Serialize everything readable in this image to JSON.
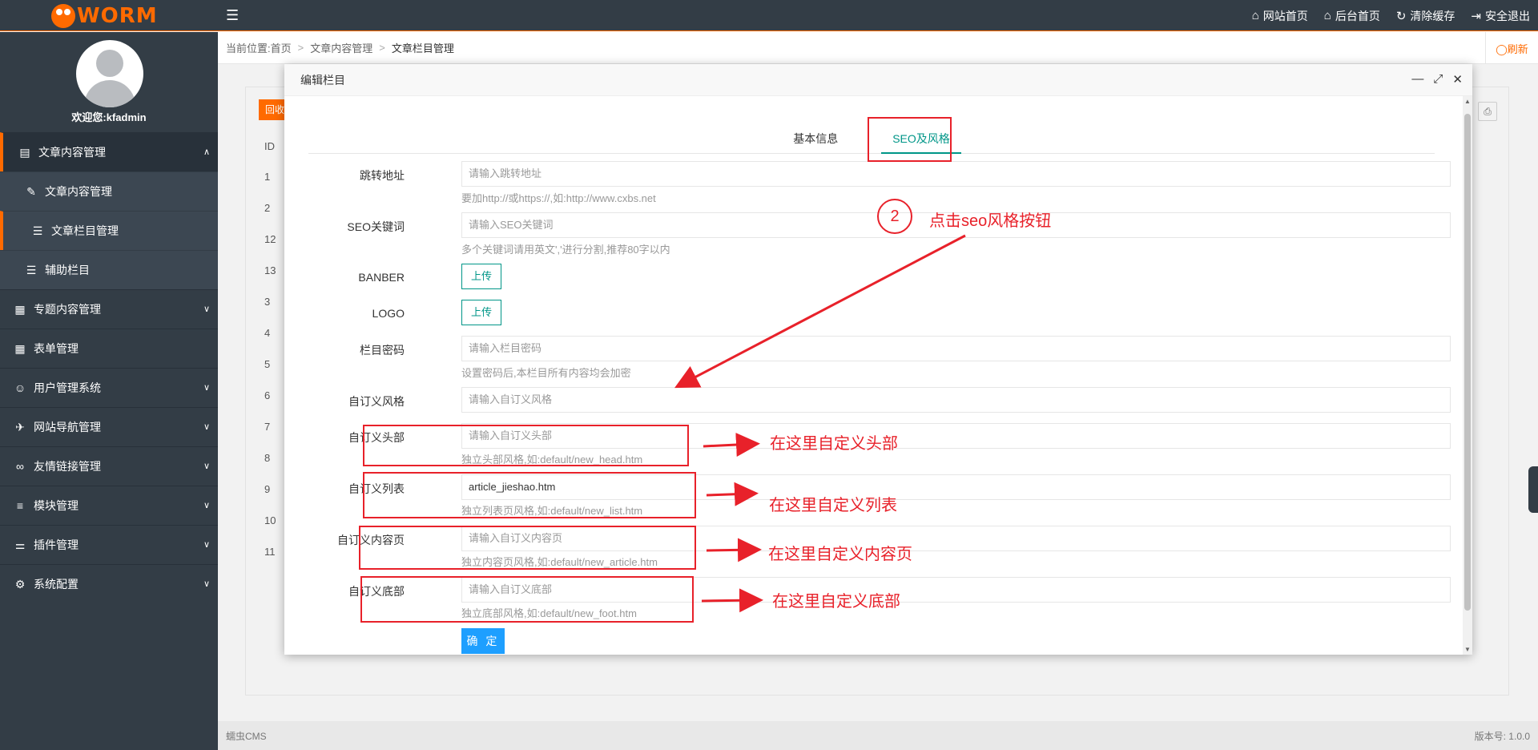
{
  "header": {
    "brand": "WORM",
    "links": [
      {
        "icon": "home-icon",
        "glyph": "⌂",
        "label": "网站首页"
      },
      {
        "icon": "admin-home-icon",
        "glyph": "⌂",
        "label": "后台首页"
      },
      {
        "icon": "refresh-cache-icon",
        "glyph": "↻",
        "label": "清除缓存"
      },
      {
        "icon": "logout-icon",
        "glyph": "⇥",
        "label": "安全退出"
      }
    ]
  },
  "sidebar": {
    "welcome": "欢迎您:kfadmin",
    "items": [
      {
        "label": "文章内容管理",
        "icon": "document-icon",
        "glyph": "▤",
        "chevron": "∧"
      },
      {
        "label": "文章内容管理",
        "icon": "edit-document-icon",
        "glyph": "✎"
      },
      {
        "label": "文章栏目管理",
        "icon": "list-icon",
        "glyph": "☰"
      },
      {
        "label": "辅助栏目",
        "icon": "list-icon",
        "glyph": "☰"
      },
      {
        "label": "专题内容管理",
        "icon": "topic-icon",
        "glyph": "▦",
        "chevron": "∨"
      },
      {
        "label": "表单管理",
        "icon": "grid-icon",
        "glyph": "▦",
        "chevron": ""
      },
      {
        "label": "用户管理系统",
        "icon": "users-icon",
        "glyph": "☺",
        "chevron": "∨"
      },
      {
        "label": "网站导航管理",
        "icon": "navigation-icon",
        "glyph": "✈",
        "chevron": "∨"
      },
      {
        "label": "友情链接管理",
        "icon": "link-icon",
        "glyph": "∞",
        "chevron": "∨"
      },
      {
        "label": "模块管理",
        "icon": "menu-icon",
        "glyph": "≡",
        "chevron": "∨"
      },
      {
        "label": "插件管理",
        "icon": "sliders-icon",
        "glyph": "⚌",
        "chevron": "∨"
      },
      {
        "label": "系统配置",
        "icon": "gear-icon",
        "glyph": "⚙",
        "chevron": "∨"
      }
    ]
  },
  "breadcrumb": {
    "prefix": "当前位置:",
    "items": [
      "首页",
      "文章内容管理",
      "文章栏目管理"
    ],
    "separator": ">",
    "refresh": "◯刷新"
  },
  "background_table": {
    "button_label": "回收",
    "header": "ID",
    "ids": [
      "1",
      "2",
      "12",
      "13",
      "3",
      "4",
      "5",
      "6",
      "7",
      "8",
      "9",
      "10",
      "11"
    ]
  },
  "footer": {
    "left": "蠕虫CMS",
    "right": "版本号: 1.0.0"
  },
  "modal": {
    "title": "编辑栏目",
    "tabs": [
      "基本信息",
      "SEO及风格"
    ],
    "active_tab": 1,
    "fields": [
      {
        "label": "跳转地址",
        "placeholder": "请输入跳转地址",
        "value": "",
        "hint": "要加http://或https://,如:http://www.cxbs.net"
      },
      {
        "label": "SEO关键词",
        "placeholder": "请输入SEO关键词",
        "value": "",
        "hint": "多个关键词请用英文','进行分割,推荐80字以内"
      },
      {
        "label": "BANBER",
        "button": "上传"
      },
      {
        "label": "LOGO",
        "button": "上传"
      },
      {
        "label": "栏目密码",
        "placeholder": "请输入栏目密码",
        "value": "",
        "hint": "设置密码后,本栏目所有内容均会加密"
      },
      {
        "label": "自订义风格",
        "placeholder": "请输入自订义风格",
        "value": "",
        "hint": ""
      },
      {
        "label": "自订义头部",
        "placeholder": "请输入自订义头部",
        "value": "",
        "hint": "独立头部风格,如:default/new_head.htm"
      },
      {
        "label": "自订义列表",
        "placeholder": "",
        "value": "article_jieshao.htm",
        "hint": "独立列表页风格,如:default/new_list.htm"
      },
      {
        "label": "自订义内容页",
        "placeholder": "请输入自订义内容页",
        "value": "",
        "hint": "独立内容页风格,如:default/new_article.htm"
      },
      {
        "label": "自订义底部",
        "placeholder": "请输入自订义底部",
        "value": "",
        "hint": "独立底部风格,如:default/new_foot.htm"
      }
    ],
    "submit": "确 定"
  },
  "annotations": {
    "step_number": "2",
    "step_text": "点击seo风格按钮",
    "notes": [
      "在这里自定义头部",
      "在这里自定义列表",
      "在这里自定义内容页",
      "在这里自定义底部"
    ],
    "color": "#e8212a"
  },
  "colors": {
    "sidebar": "#333d46",
    "accent": "#ff6a00",
    "tab_active": "#009688",
    "primary_button": "#1e9fff"
  }
}
